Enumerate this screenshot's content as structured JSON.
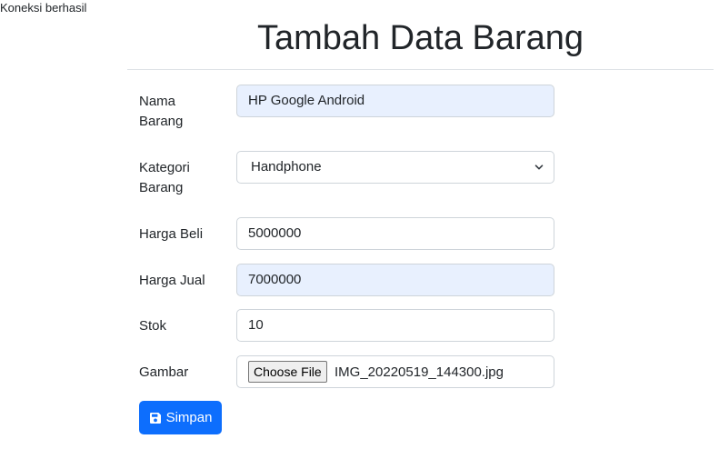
{
  "status_message": "Koneksi berhasil",
  "page_title": "Tambah Data Barang",
  "form": {
    "nama_barang": {
      "label": "Nama Barang",
      "value": "HP Google Android"
    },
    "kategori_barang": {
      "label": "Kategori Barang",
      "selected": "Handphone"
    },
    "harga_beli": {
      "label": "Harga Beli",
      "value": "5000000"
    },
    "harga_jual": {
      "label": "Harga Jual",
      "value": "7000000"
    },
    "stok": {
      "label": "Stok",
      "value": "10"
    },
    "gambar": {
      "label": "Gambar",
      "button_label": "Choose File",
      "file_name": "IMG_20220519_144300.jpg"
    }
  },
  "save_button": {
    "label": "Simpan",
    "icon": "floppy-disk-icon"
  },
  "colors": {
    "primary": "#0d6efd",
    "autofill_background": "#e8f0fe",
    "border": "#ced4da"
  }
}
